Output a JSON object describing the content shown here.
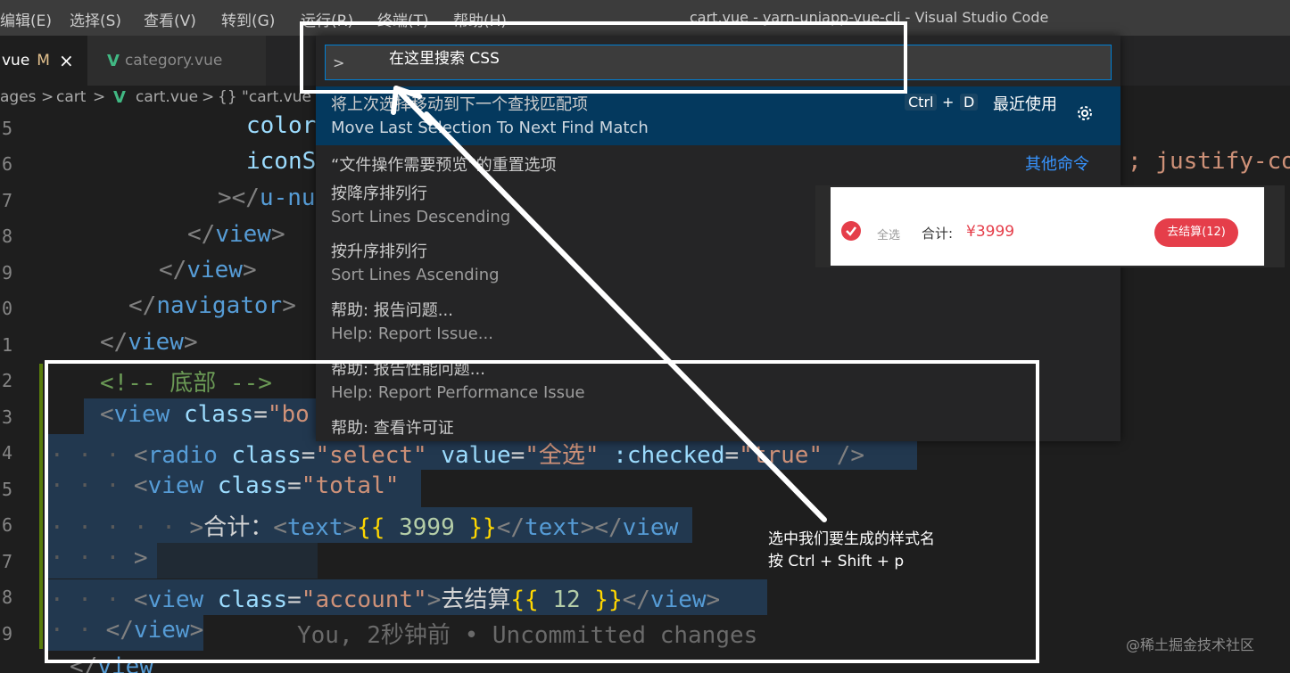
{
  "titlebar": {
    "menus": [
      "编辑(E)",
      "选择(S)",
      "查看(V)",
      "转到(G)",
      "运行(R)",
      "终端(T)",
      "帮助(H)"
    ],
    "window_title": "cart.vue - yarn-uniapp-vue-cli - Visual Studio Code"
  },
  "tabs": [
    {
      "label": "vue",
      "badge": "M",
      "close": "×",
      "active": true
    },
    {
      "label": "category.vue",
      "active": false
    }
  ],
  "breadcrumbs": [
    "ages",
    "cart",
    "cart.vue",
    "{} \"cart.vue"
  ],
  "gutter": {
    "line_numbers": [
      "5",
      "6",
      "7",
      "8",
      "9",
      "0",
      "1",
      "2",
      "3",
      "4",
      "5",
      "6",
      "7",
      "8",
      "9"
    ]
  },
  "editor": {
    "l1_attr": "color",
    "l2_attr": "iconS",
    "l2_tail": "; justify-co",
    "l3_tag": "u-nu",
    "l4_tag": "view",
    "l5_tag": "view",
    "l6_tag": "navigator",
    "l7_tag": "view",
    "l8_comment": "<!-- 底部 -->",
    "l9_tag": "view",
    "l9_attr": "class",
    "l9_val": "\"bo",
    "l10_tag": "radio",
    "l10_a1": "class",
    "l10_v1": "\"select\"",
    "l10_a2": "value",
    "l10_v2": "\"全选\"",
    "l10_a3": ":checked",
    "l10_v3": "\"true\"",
    "l11_tag": "view",
    "l11_attr": "class",
    "l11_val": "\"total\"",
    "l12_text": "合计：",
    "l12_tag": "text",
    "l12_num": "3999",
    "l12_close1": "text",
    "l12_close2": "view",
    "l14_tag": "view",
    "l14_attr": "class",
    "l14_val": "\"account\"",
    "l14_text": "去结算",
    "l14_num": "12",
    "l14_close": "view",
    "l15_tag": "view",
    "l16_tag": "view",
    "blame": "You, 2秒钟前 • Uncommitted changes"
  },
  "palette": {
    "input_value": ">",
    "items": [
      {
        "label": "将上次选择移动到下一个查找匹配项",
        "detail": "Move Last Selection To Next Find Match",
        "keys": [
          "Ctrl",
          "D"
        ],
        "plus": "+",
        "group": "最近使用"
      },
      {
        "label": "“文件操作需要预览”的重置选项",
        "group": "其他命令"
      },
      {
        "label": "按降序排列行",
        "detail": "Sort Lines Descending"
      },
      {
        "label": "按升序排列行",
        "detail": "Sort Lines Ascending"
      },
      {
        "label": "帮助: 报告问题...",
        "detail": "Help: Report Issue..."
      },
      {
        "label": "帮助: 报告性能问题...",
        "detail": "Help: Report Performance Issue"
      },
      {
        "label": "帮助: 查看许可证"
      }
    ]
  },
  "annotations": {
    "search_hint": "在这里搜索   CSS",
    "note_line1": "选中我们要生成的样式名",
    "note_line2": "按 Ctrl + Shift + p"
  },
  "preview": {
    "select_all": "全选",
    "total_label": "合计:",
    "price": "¥3999",
    "checkout": "去结算(12)"
  },
  "watermark": "@稀土掘金技术社区",
  "colors": {
    "accent": "#007fd4",
    "selected_row": "#04395e",
    "brand_red": "#e53e4a"
  }
}
